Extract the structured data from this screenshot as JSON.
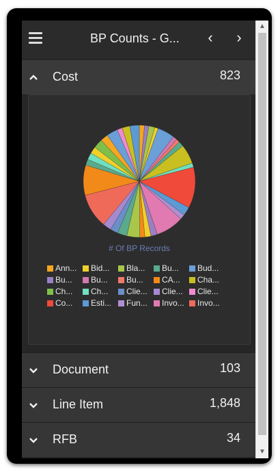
{
  "header": {
    "title": "BP Counts - G..."
  },
  "sections": [
    {
      "label": "Cost",
      "count": "823"
    },
    {
      "label": "Document",
      "count": "103"
    },
    {
      "label": "Line Item",
      "count": "1,848"
    },
    {
      "label": "RFB",
      "count": "34"
    }
  ],
  "icons": {
    "menu": "hamburger-menu-icon",
    "prev": "chevron-left-icon",
    "next": "chevron-right-icon",
    "expanded": "chevron-up-icon",
    "collapsed": "chevron-down-icon"
  },
  "chart_data": {
    "type": "pie",
    "ylabel": "# Of BP Records",
    "legend": [
      {
        "label": "Ann...",
        "color": "#f5a623"
      },
      {
        "label": "Bid...",
        "color": "#f0d02a"
      },
      {
        "label": "Bla...",
        "color": "#a8c64a"
      },
      {
        "label": "Bu...",
        "color": "#5aaa8c"
      },
      {
        "label": "Bud...",
        "color": "#6a9fd8"
      },
      {
        "label": "Bu...",
        "color": "#9b7fc4"
      },
      {
        "label": "Bu...",
        "color": "#d478b0"
      },
      {
        "label": "Bu...",
        "color": "#f07a6a"
      },
      {
        "label": "CA...",
        "color": "#f28a1a"
      },
      {
        "label": "Cha...",
        "color": "#c9bf20"
      },
      {
        "label": "Ch...",
        "color": "#7fbf4a"
      },
      {
        "label": "Ch...",
        "color": "#6fe0c0"
      },
      {
        "label": "Clie...",
        "color": "#6a8fc8"
      },
      {
        "label": "Clie...",
        "color": "#a58ad0"
      },
      {
        "label": "Clie...",
        "color": "#f08ad0"
      },
      {
        "label": "Co...",
        "color": "#f04a3a"
      },
      {
        "label": "Esti...",
        "color": "#5b9bd5"
      },
      {
        "label": "Fun...",
        "color": "#b08fd0"
      },
      {
        "label": "Invo...",
        "color": "#e07ab0"
      },
      {
        "label": "Invo...",
        "color": "#f06a5a"
      }
    ],
    "slices": [
      {
        "color": "#f5a623",
        "value": 12
      },
      {
        "color": "#9b7fc4",
        "value": 10
      },
      {
        "color": "#a8c64a",
        "value": 14
      },
      {
        "color": "#f0d02a",
        "value": 8
      },
      {
        "color": "#6a9fd8",
        "value": 40
      },
      {
        "color": "#d478b0",
        "value": 10
      },
      {
        "color": "#f07a6a",
        "value": 8
      },
      {
        "color": "#5aaa8c",
        "value": 12
      },
      {
        "color": "#c9bf20",
        "value": 45
      },
      {
        "color": "#6fe0c0",
        "value": 10
      },
      {
        "color": "#f04a3a",
        "value": 95
      },
      {
        "color": "#5b9bd5",
        "value": 20
      },
      {
        "color": "#b08fd0",
        "value": 12
      },
      {
        "color": "#e07ab0",
        "value": 65
      },
      {
        "color": "#9b7fc4",
        "value": 15
      },
      {
        "color": "#f0d02a",
        "value": 14
      },
      {
        "color": "#f28a1a",
        "value": 12
      },
      {
        "color": "#a8c64a",
        "value": 30
      },
      {
        "color": "#5aaa8c",
        "value": 22
      },
      {
        "color": "#6a8fc8",
        "value": 18
      },
      {
        "color": "#a58ad0",
        "value": 20
      },
      {
        "color": "#f06a5a",
        "value": 80
      },
      {
        "color": "#f28a1a",
        "value": 70
      },
      {
        "color": "#5aaa8c",
        "value": 14
      },
      {
        "color": "#6fe0c0",
        "value": 16
      },
      {
        "color": "#f0d02a",
        "value": 16
      },
      {
        "color": "#7fbf4a",
        "value": 22
      },
      {
        "color": "#f5a623",
        "value": 18
      },
      {
        "color": "#6a9fd8",
        "value": 26
      },
      {
        "color": "#f08ad0",
        "value": 12
      },
      {
        "color": "#c9bf20",
        "value": 18
      },
      {
        "color": "#5b9bd5",
        "value": 22
      }
    ]
  }
}
